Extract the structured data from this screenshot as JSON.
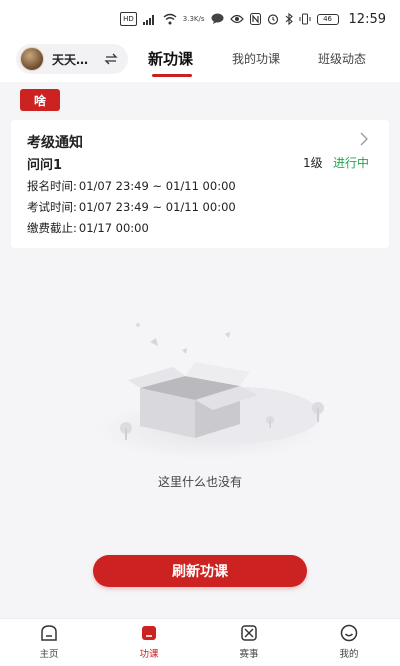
{
  "status_bar": {
    "hd_label": "HD",
    "signal_label": "5G",
    "speed_value": "3.3",
    "speed_unit": "K/s",
    "battery": "46",
    "time": "12:59"
  },
  "header": {
    "user_name": "天天…",
    "tabs": [
      {
        "label": "新功课",
        "active": true
      },
      {
        "label": "我的功课",
        "active": false
      },
      {
        "label": "班级动态",
        "active": false
      }
    ]
  },
  "tag_label": "啥",
  "card": {
    "title": "考级通知",
    "exam_name": "问问1",
    "level": "1级",
    "status": "进行中",
    "rows": [
      {
        "label": "报名时间:",
        "value": "01/07 23:49 ~ 01/11 00:00"
      },
      {
        "label": "考试时间:",
        "value": "01/07 23:49 ~ 01/11 00:00"
      },
      {
        "label": "缴费截止:",
        "value": "01/17 00:00"
      }
    ]
  },
  "empty_text": "这里什么也没有",
  "refresh_label": "刷新功课",
  "bottom_nav": [
    {
      "label": "主页",
      "icon": "home-icon"
    },
    {
      "label": "功课",
      "icon": "course-icon",
      "active": true
    },
    {
      "label": "赛事",
      "icon": "match-icon"
    },
    {
      "label": "我的",
      "icon": "profile-icon"
    }
  ],
  "colors": {
    "accent": "#cc2222",
    "status_green": "#1fa74a"
  }
}
